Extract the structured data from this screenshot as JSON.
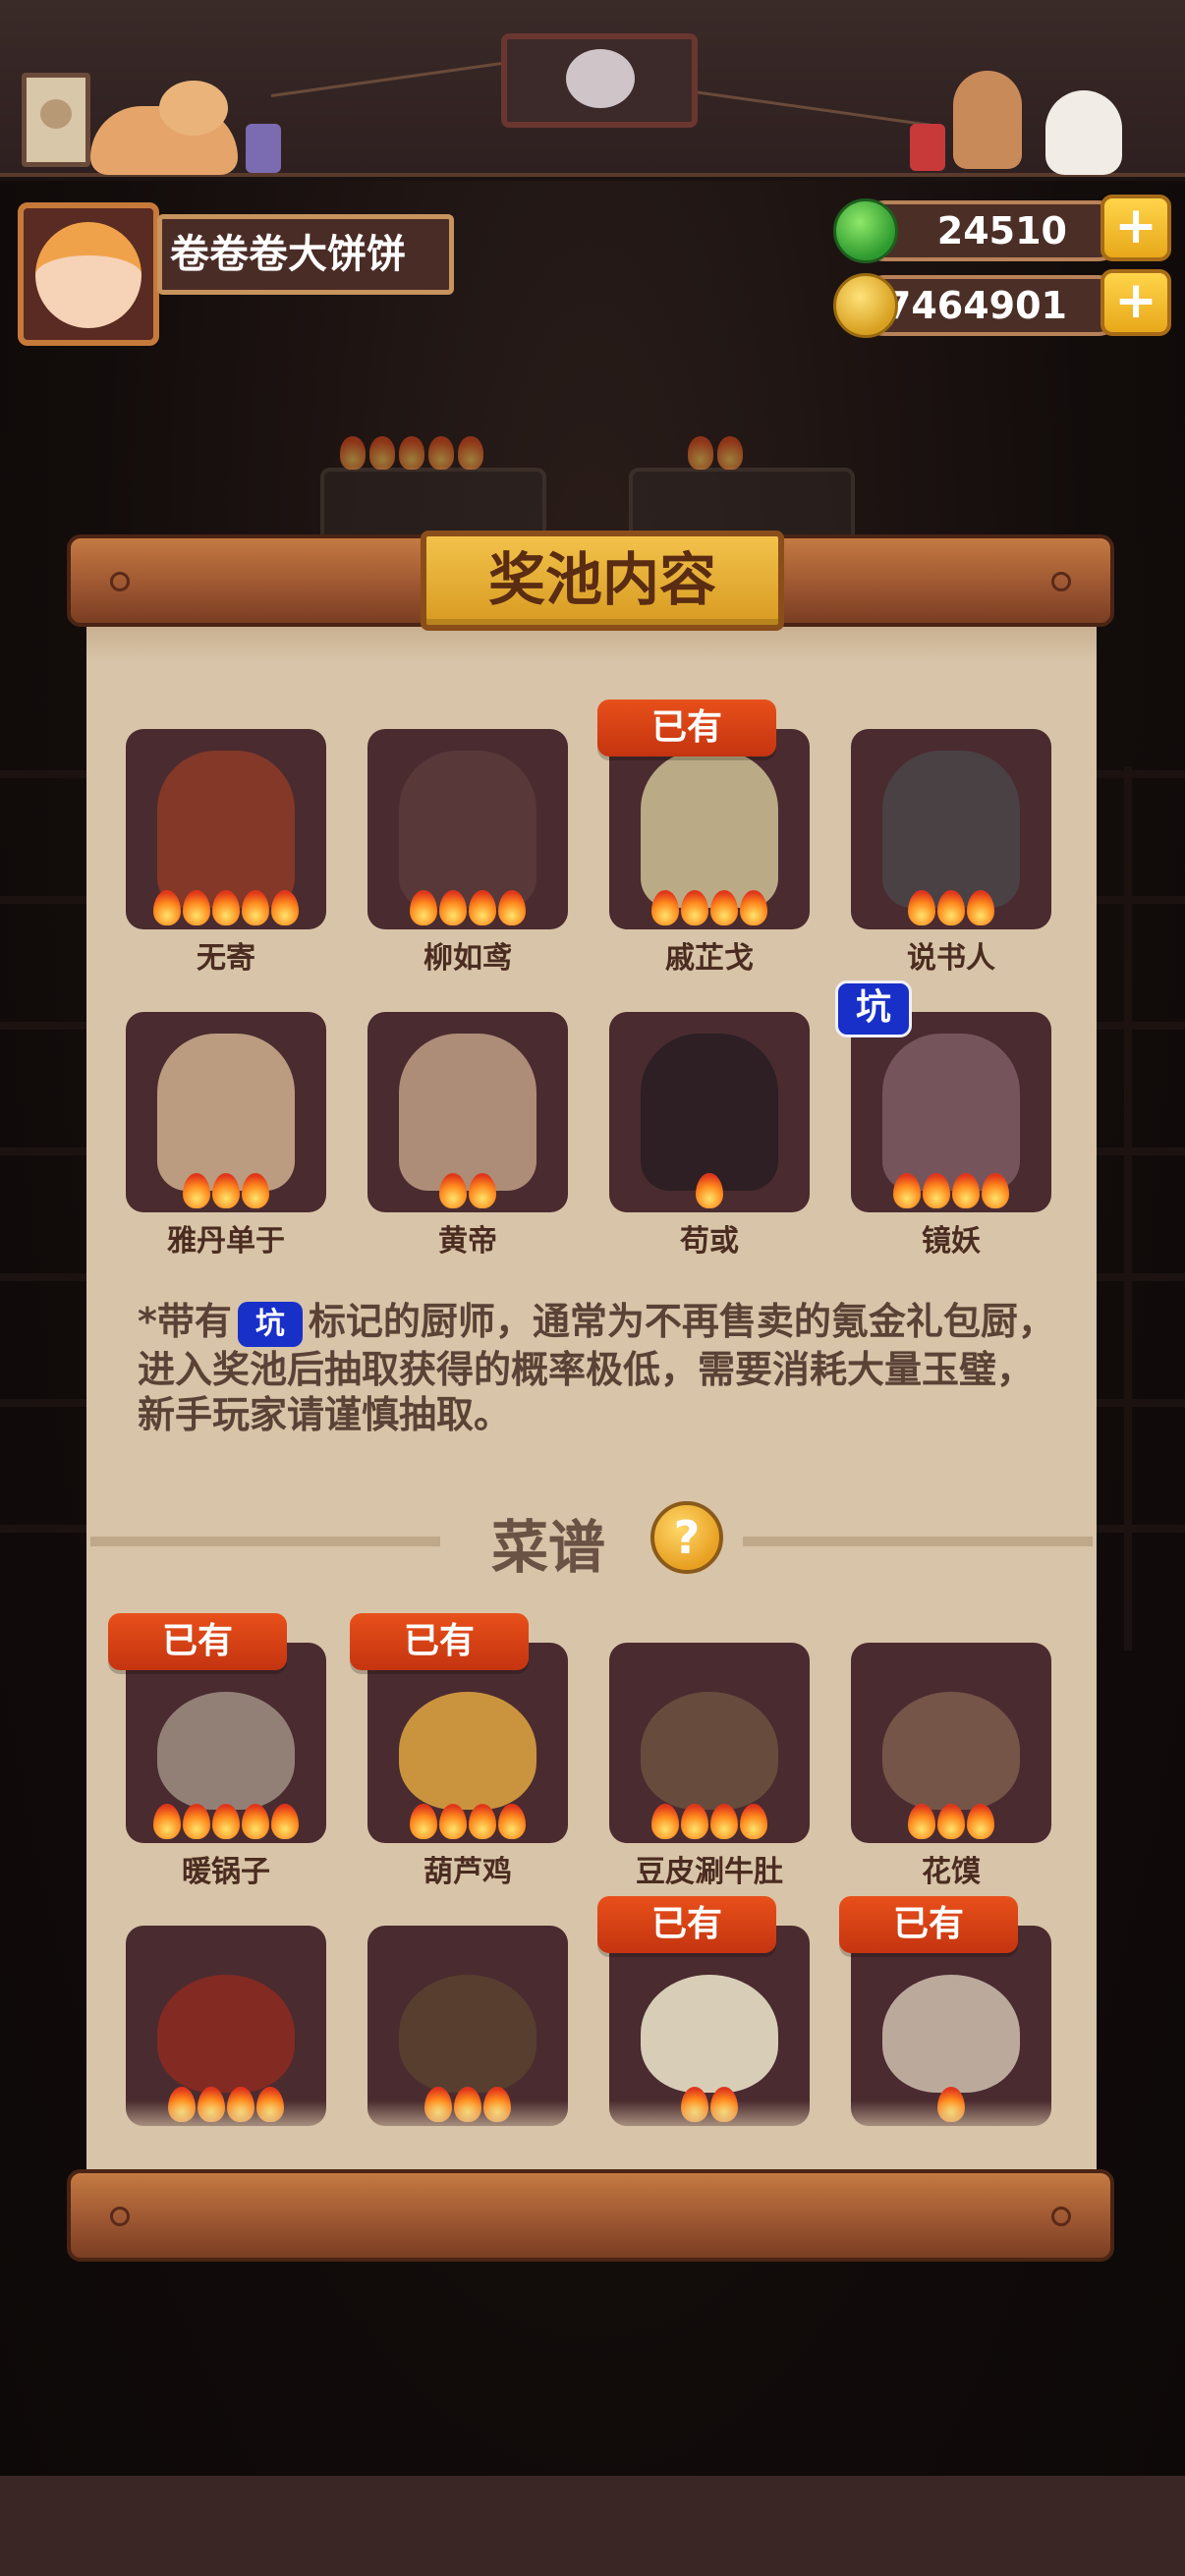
{
  "player": {
    "name": "卷卷卷大饼饼"
  },
  "currencies": {
    "jade": "24510",
    "coins": "47464901",
    "plus_label": "+"
  },
  "panel": {
    "title": "奖池内容"
  },
  "chefs": [
    {
      "name": "无寄",
      "stars": 5,
      "owned": false,
      "keng": false,
      "color": "#8a3a28"
    },
    {
      "name": "柳如鸢",
      "stars": 4,
      "owned": false,
      "keng": false,
      "color": "#5a3a3a"
    },
    {
      "name": "戚芷戈",
      "stars": 4,
      "owned": true,
      "keng": false,
      "color": "#c8b890"
    },
    {
      "name": "说书人",
      "stars": 3,
      "owned": false,
      "keng": false,
      "color": "#4a4448"
    },
    {
      "name": "雅丹单于",
      "stars": 3,
      "owned": false,
      "keng": false,
      "color": "#c8a88a"
    },
    {
      "name": "黄帝",
      "stars": 2,
      "owned": false,
      "keng": false,
      "color": "#b89880"
    },
    {
      "name": "苟或",
      "stars": 1,
      "owned": false,
      "keng": false,
      "color": "#2a1e24"
    },
    {
      "name": "镜妖",
      "stars": 4,
      "owned": false,
      "keng": true,
      "color": "#7a5a60"
    }
  ],
  "badges": {
    "owned": "已有",
    "keng": "坑"
  },
  "note": {
    "prefix": "*带有",
    "suffix": "标记的厨师，通常为不再售卖的氪金礼包厨，进入奖池后抽取获得的概率极低，需要消耗大量玉璧，新手玩家请谨慎抽取。"
  },
  "recipes_section": {
    "title": "菜谱",
    "help_label": "?"
  },
  "recipes": [
    {
      "name": "暖锅子",
      "stars": 5,
      "owned": true,
      "color": "#9a8a80"
    },
    {
      "name": "葫芦鸡",
      "stars": 4,
      "owned": true,
      "color": "#d8a040"
    },
    {
      "name": "豆皮涮牛肚",
      "stars": 4,
      "owned": false,
      "color": "#6a5040"
    },
    {
      "name": "花馍",
      "stars": 3,
      "owned": false,
      "color": "#7a5a4a"
    },
    {
      "name": "",
      "stars": 4,
      "owned": false,
      "color": "#8a2a22"
    },
    {
      "name": "",
      "stars": 3,
      "owned": false,
      "color": "#5a4030"
    },
    {
      "name": "",
      "stars": 2,
      "owned": true,
      "color": "#e8e0c8"
    },
    {
      "name": "",
      "stars": 1,
      "owned": true,
      "color": "#c8b8a8"
    }
  ]
}
